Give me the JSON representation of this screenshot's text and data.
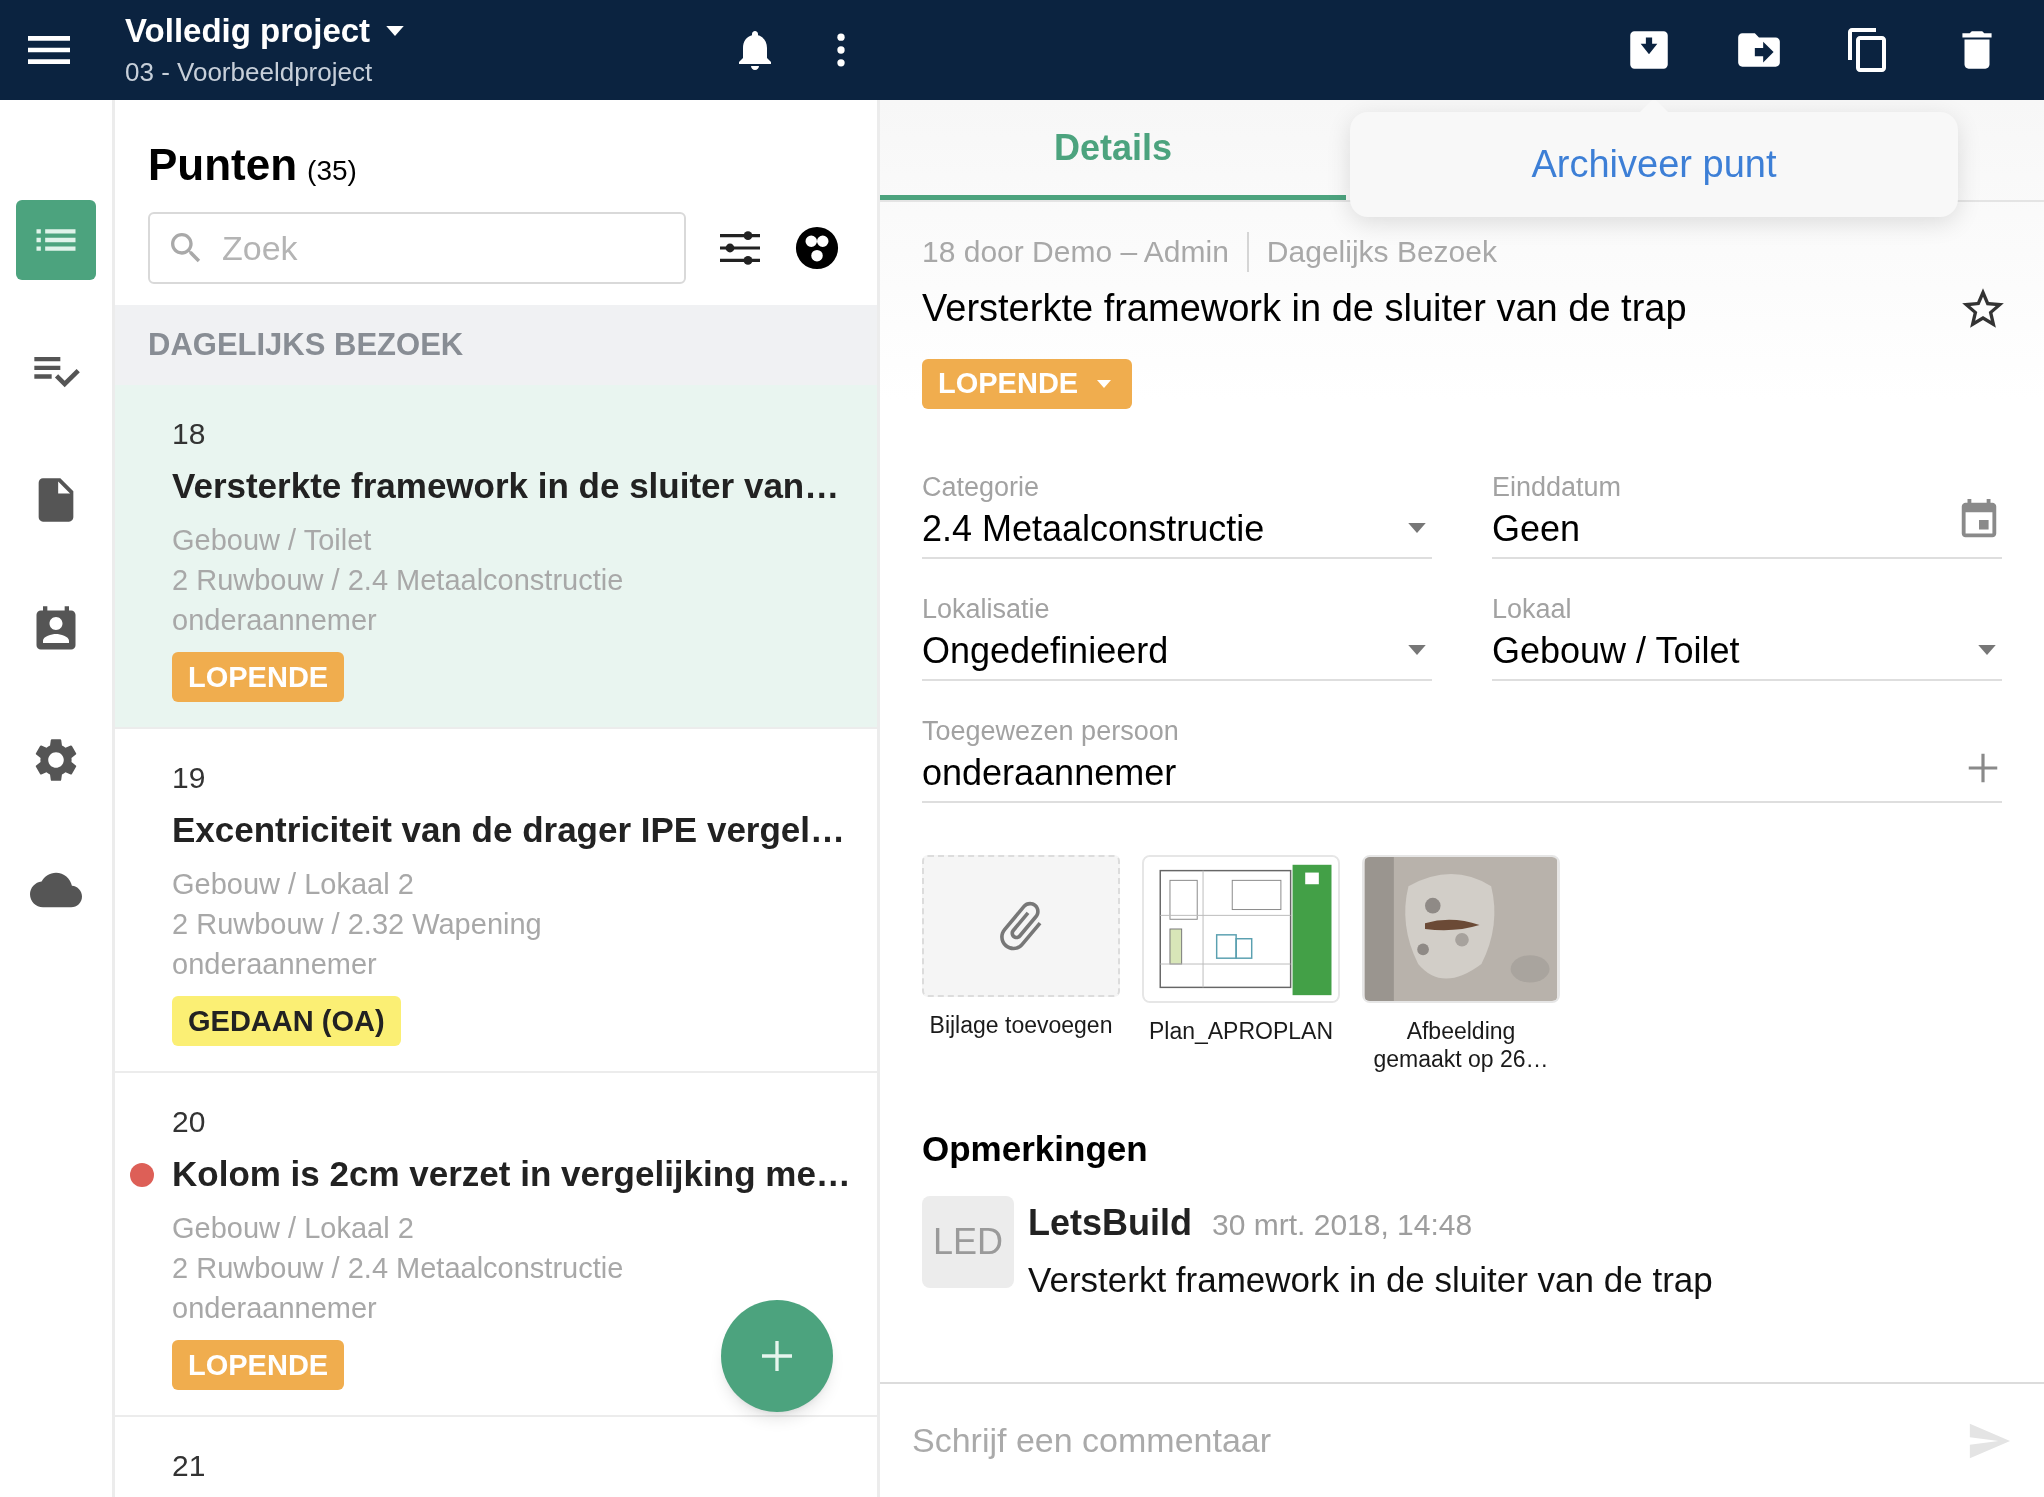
{
  "header": {
    "title": "Volledig project",
    "subtitle": "03 - Voorbeeldproject"
  },
  "tooltip": {
    "text": "Archiveer punt"
  },
  "rail": [
    {
      "kind": "list",
      "selected": true
    },
    {
      "kind": "checklist",
      "selected": false
    },
    {
      "kind": "document",
      "selected": false
    },
    {
      "kind": "contact",
      "selected": false
    },
    {
      "kind": "settings",
      "selected": false
    },
    {
      "kind": "cloud",
      "selected": false
    }
  ],
  "list": {
    "title": "Punten",
    "count": "(35)",
    "search": {
      "placeholder": "Zoek"
    },
    "section": "DAGELIJKS BEZOEK",
    "items": [
      {
        "number": "18",
        "title": "Versterkte framework in de sluiter van…",
        "location": "Gebouw / Toilet",
        "category": "2 Ruwbouw / 2.4 Metaalconstructie",
        "assignee": "onderaannemer",
        "status": {
          "label": "LOPENDE",
          "color": "#f0ad4e"
        },
        "selected": true
      },
      {
        "number": "19",
        "title": "Excentriciteit van de drager IPE vergel…",
        "location": "Gebouw / Lokaal 2",
        "category": "2 Ruwbouw / 2.32 Wapening",
        "assignee": "onderaannemer",
        "status": {
          "label": "GEDAAN (OA)",
          "color": "#fbef74"
        },
        "selected": false
      },
      {
        "number": "20",
        "color": "#dd5f57",
        "title": "Kolom is 2cm verzet in vergelijking me…",
        "location": "Gebouw / Lokaal 2",
        "category": "2 Ruwbouw / 2.4 Metaalconstructie",
        "assignee": "onderaannemer",
        "status": {
          "label": "LOPENDE",
          "color": "#f0ad4e"
        },
        "selected": false
      },
      {
        "number": "21",
        "selected": false
      }
    ]
  },
  "detail": {
    "tabs": [
      {
        "label": "Details",
        "selected": true
      }
    ],
    "meta": {
      "author": "18 door Demo – Admin",
      "type": "Dagelijks Bezoek"
    },
    "title": "Versterkte framework in de sluiter van de trap",
    "starred": false,
    "status": {
      "label": "LOPENDE",
      "color": "#f0ad4e"
    },
    "fields": [
      {
        "kind": "select",
        "label": "Categorie",
        "value": "2.4 Metaalconstructie"
      },
      {
        "kind": "date",
        "label": "Einddatum",
        "value": "Geen"
      },
      {
        "kind": "select",
        "label": "Lokalisatie",
        "value": "Ongedefinieerd"
      },
      {
        "kind": "select",
        "label": "Lokaal",
        "value": "Gebouw / Toilet"
      },
      {
        "kind": "person",
        "label": "Toegewezen persoon",
        "value": "onderaannemer"
      }
    ],
    "attachments": [
      {
        "kind": "add",
        "label": "Bijlage toevoegen"
      },
      {
        "kind": "plan",
        "label": "Plan_APROPLAN"
      },
      {
        "label": "Afbeelding gemaakt op 26…"
      }
    ],
    "comments_title": "Opmerkingen",
    "comments": [
      {
        "initials": "LED",
        "author": "LetsBuild",
        "time": "30 mrt. 2018, 14:48",
        "text": "Versterkt framework in de sluiter van de trap"
      }
    ],
    "comment_input": {
      "placeholder": "Schrijf een commentaar"
    }
  }
}
